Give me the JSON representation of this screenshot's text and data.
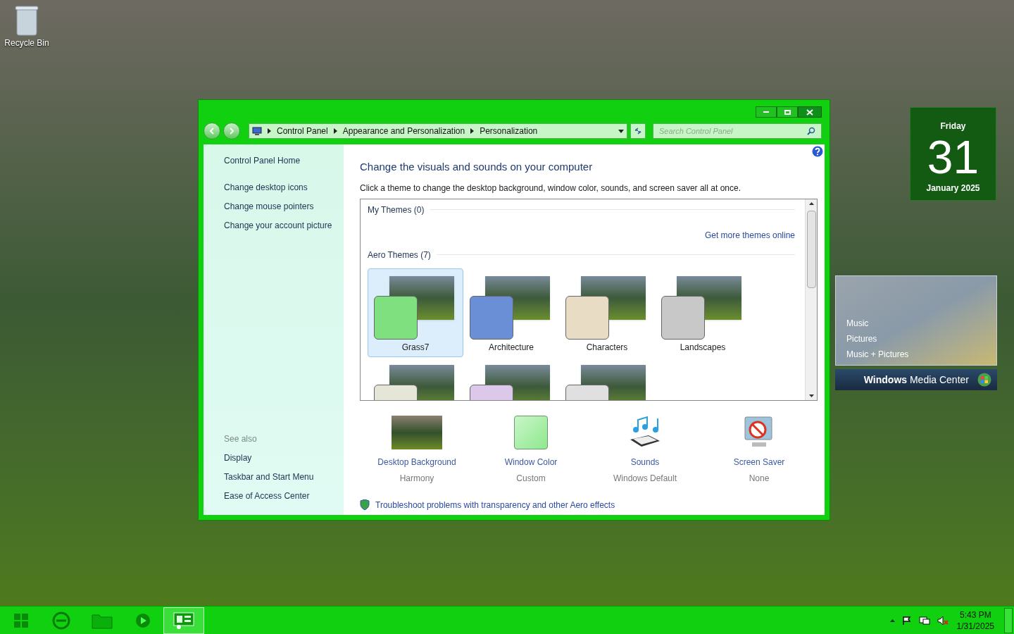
{
  "desktop": {
    "icons": [
      {
        "label": "Recycle Bin"
      }
    ]
  },
  "window": {
    "breadcrumb": [
      "Control Panel",
      "Appearance and Personalization",
      "Personalization"
    ],
    "search": {
      "placeholder": "Search Control Panel"
    },
    "sidebar": {
      "home": "Control Panel Home",
      "links": [
        "Change desktop icons",
        "Change mouse pointers",
        "Change your account picture"
      ],
      "see_also_title": "See also",
      "see_also": [
        "Display",
        "Taskbar and Start Menu",
        "Ease of Access Center"
      ]
    },
    "title": "Change the visuals and sounds on your computer",
    "description": "Click a theme to change the desktop background, window color, sounds, and screen saver all at once.",
    "my_themes": {
      "heading": "My Themes (0)",
      "link": "Get more themes online"
    },
    "aero_themes": {
      "heading": "Aero Themes (7)",
      "items": [
        {
          "label": "Grass7",
          "selected": true,
          "color": "#7fe07f"
        },
        {
          "label": "Architecture",
          "selected": false,
          "color": "#6b8fd6"
        },
        {
          "label": "Characters",
          "selected": false,
          "color": "#e8dcc4"
        },
        {
          "label": "Landscapes",
          "selected": false,
          "color": "#c8c8c8"
        },
        {
          "selected": false,
          "color": "#e6e6d8"
        },
        {
          "selected": false,
          "color": "#dcc8e8"
        },
        {
          "selected": false,
          "color": "#e0e0e0"
        }
      ]
    },
    "settings": [
      {
        "kind": "background",
        "label": "Desktop Background",
        "value": "Harmony"
      },
      {
        "kind": "color",
        "label": "Window Color",
        "value": "Custom"
      },
      {
        "kind": "sounds",
        "label": "Sounds",
        "value": "Windows Default"
      },
      {
        "kind": "screensaver",
        "label": "Screen Saver",
        "value": "None"
      }
    ],
    "troubleshoot": "Troubleshoot problems with transparency and other Aero effects"
  },
  "gadgets": {
    "calendar": {
      "weekday": "Friday",
      "day": "31",
      "month_year": "January 2025"
    },
    "media_center": {
      "items": [
        "Music",
        "Pictures",
        "Music + Pictures"
      ],
      "brand_bold": "Windows",
      "brand_rest": "Media Center"
    }
  },
  "taskbar": {
    "apps": [
      {
        "kind": "browser",
        "selected": false
      },
      {
        "kind": "folder",
        "selected": false
      },
      {
        "kind": "player",
        "selected": false
      },
      {
        "kind": "control-panel",
        "selected": true
      }
    ],
    "time": "5:43 PM",
    "date": "1/31/2025"
  }
}
